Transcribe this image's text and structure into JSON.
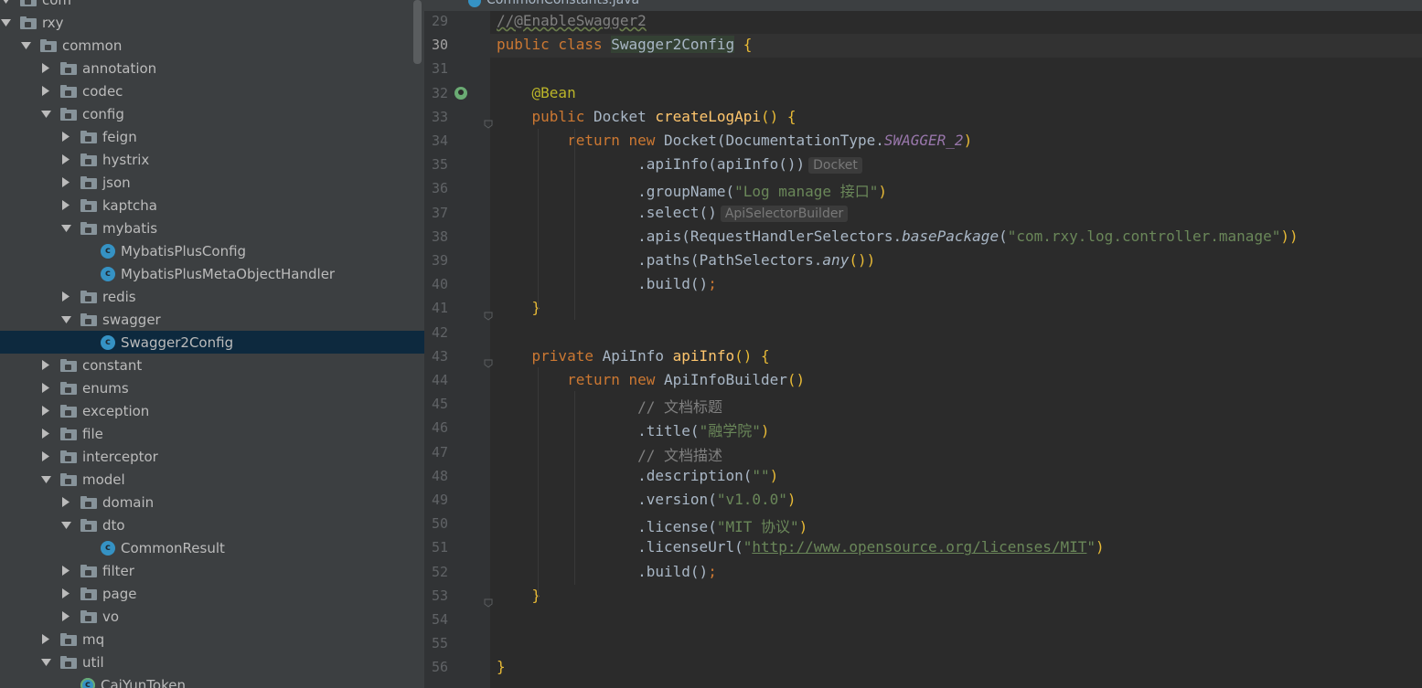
{
  "tab": {
    "title": "CommonConstants.java"
  },
  "tree": {
    "items": [
      {
        "label": "com",
        "depth": 0,
        "kind": "folder",
        "state": "expanded"
      },
      {
        "label": "rxy",
        "depth": 0,
        "kind": "folder",
        "state": "expanded"
      },
      {
        "label": "common",
        "depth": 1,
        "kind": "folder",
        "state": "expanded"
      },
      {
        "label": "annotation",
        "depth": 2,
        "kind": "folder",
        "state": "collapsed"
      },
      {
        "label": "codec",
        "depth": 2,
        "kind": "folder",
        "state": "collapsed"
      },
      {
        "label": "config",
        "depth": 2,
        "kind": "folder",
        "state": "expanded"
      },
      {
        "label": "feign",
        "depth": 3,
        "kind": "folder",
        "state": "collapsed"
      },
      {
        "label": "hystrix",
        "depth": 3,
        "kind": "folder",
        "state": "collapsed"
      },
      {
        "label": "json",
        "depth": 3,
        "kind": "folder",
        "state": "collapsed"
      },
      {
        "label": "kaptcha",
        "depth": 3,
        "kind": "folder",
        "state": "collapsed"
      },
      {
        "label": "mybatis",
        "depth": 3,
        "kind": "folder",
        "state": "expanded"
      },
      {
        "label": "MybatisPlusConfig",
        "depth": 4,
        "kind": "class"
      },
      {
        "label": "MybatisPlusMetaObjectHandler",
        "depth": 4,
        "kind": "class"
      },
      {
        "label": "redis",
        "depth": 3,
        "kind": "folder",
        "state": "collapsed"
      },
      {
        "label": "swagger",
        "depth": 3,
        "kind": "folder",
        "state": "expanded"
      },
      {
        "label": "Swagger2Config",
        "depth": 4,
        "kind": "class",
        "selected": true
      },
      {
        "label": "constant",
        "depth": 2,
        "kind": "folder",
        "state": "collapsed"
      },
      {
        "label": "enums",
        "depth": 2,
        "kind": "folder",
        "state": "collapsed"
      },
      {
        "label": "exception",
        "depth": 2,
        "kind": "folder",
        "state": "collapsed"
      },
      {
        "label": "file",
        "depth": 2,
        "kind": "folder",
        "state": "collapsed"
      },
      {
        "label": "interceptor",
        "depth": 2,
        "kind": "folder",
        "state": "collapsed"
      },
      {
        "label": "model",
        "depth": 2,
        "kind": "folder",
        "state": "expanded"
      },
      {
        "label": "domain",
        "depth": 3,
        "kind": "folder",
        "state": "collapsed"
      },
      {
        "label": "dto",
        "depth": 3,
        "kind": "folder",
        "state": "expanded"
      },
      {
        "label": "CommonResult",
        "depth": 4,
        "kind": "class"
      },
      {
        "label": "filter",
        "depth": 3,
        "kind": "folder",
        "state": "collapsed"
      },
      {
        "label": "page",
        "depth": 3,
        "kind": "folder",
        "state": "collapsed"
      },
      {
        "label": "vo",
        "depth": 3,
        "kind": "folder",
        "state": "collapsed"
      },
      {
        "label": "mq",
        "depth": 2,
        "kind": "folder",
        "state": "collapsed"
      },
      {
        "label": "util",
        "depth": 2,
        "kind": "folder",
        "state": "expanded"
      },
      {
        "label": "CaiYunToken",
        "depth": 3,
        "kind": "class-spring"
      }
    ]
  },
  "editor": {
    "current_line": 30,
    "lines": [
      {
        "n": 29,
        "tokens": [
          {
            "t": "//@EnableSwagger2",
            "c": "cmu"
          }
        ]
      },
      {
        "n": 30,
        "tokens": [
          {
            "t": "public class ",
            "c": "kw"
          },
          {
            "t": "Swagger2Config",
            "c": "hl"
          },
          {
            "t": " {",
            "c": "py"
          }
        ]
      },
      {
        "n": 31,
        "tokens": []
      },
      {
        "n": 32,
        "tokens": [
          {
            "t": "    "
          },
          {
            "t": "@Bean",
            "c": "an"
          }
        ]
      },
      {
        "n": 33,
        "tokens": [
          {
            "t": "    "
          },
          {
            "t": "public ",
            "c": "kw"
          },
          {
            "t": "Docket "
          },
          {
            "t": "createLogApi",
            "c": "fn"
          },
          {
            "t": "() {",
            "c": "py"
          }
        ]
      },
      {
        "n": 34,
        "tokens": [
          {
            "t": "        "
          },
          {
            "t": "return new ",
            "c": "kw"
          },
          {
            "t": "Docket("
          },
          {
            "t": "DocumentationType."
          },
          {
            "t": "SWAGGER_2",
            "c": "sf"
          },
          {
            "t": ")",
            "c": "py"
          }
        ]
      },
      {
        "n": 35,
        "tokens": [
          {
            "t": "                .apiInfo("
          },
          {
            "t": "apiInfo())"
          },
          {
            "t": "Docket",
            "c": "hint"
          }
        ]
      },
      {
        "n": 36,
        "tokens": [
          {
            "t": "                .groupName("
          },
          {
            "t": "\"Log manage 接口\"",
            "c": "st"
          },
          {
            "t": ")",
            "c": "py"
          }
        ]
      },
      {
        "n": 37,
        "tokens": [
          {
            "t": "                .select()"
          },
          {
            "t": "ApiSelectorBuilder",
            "c": "hint"
          }
        ]
      },
      {
        "n": 38,
        "tokens": [
          {
            "t": "                .apis("
          },
          {
            "t": "RequestHandlerSelectors."
          },
          {
            "t": "basePackage",
            "c": "it"
          },
          {
            "t": "("
          },
          {
            "t": "\"com.rxy.log.controller.manage\"",
            "c": "st"
          },
          {
            "t": "))",
            "c": "py"
          }
        ]
      },
      {
        "n": 39,
        "tokens": [
          {
            "t": "                .paths("
          },
          {
            "t": "PathSelectors."
          },
          {
            "t": "any",
            "c": "it"
          },
          {
            "t": "())",
            "c": "py"
          }
        ]
      },
      {
        "n": 40,
        "tokens": [
          {
            "t": "                .build()"
          },
          {
            "t": ";",
            "c": "kw"
          }
        ]
      },
      {
        "n": 41,
        "tokens": [
          {
            "t": "    "
          },
          {
            "t": "}",
            "c": "py"
          }
        ]
      },
      {
        "n": 42,
        "tokens": []
      },
      {
        "n": 43,
        "tokens": [
          {
            "t": "    "
          },
          {
            "t": "private ",
            "c": "kw"
          },
          {
            "t": "ApiInfo "
          },
          {
            "t": "apiInfo",
            "c": "fn"
          },
          {
            "t": "() {",
            "c": "py"
          }
        ]
      },
      {
        "n": 44,
        "tokens": [
          {
            "t": "        "
          },
          {
            "t": "return new ",
            "c": "kw"
          },
          {
            "t": "ApiInfoBuilder"
          },
          {
            "t": "()",
            "c": "py"
          }
        ]
      },
      {
        "n": 45,
        "tokens": [
          {
            "t": "                "
          },
          {
            "t": "// 文档标题",
            "c": "cm"
          }
        ]
      },
      {
        "n": 46,
        "tokens": [
          {
            "t": "                .title("
          },
          {
            "t": "\"融学院\"",
            "c": "st"
          },
          {
            "t": ")",
            "c": "py"
          }
        ]
      },
      {
        "n": 47,
        "tokens": [
          {
            "t": "                "
          },
          {
            "t": "// 文档描述",
            "c": "cm"
          }
        ]
      },
      {
        "n": 48,
        "tokens": [
          {
            "t": "                .description("
          },
          {
            "t": "\"\"",
            "c": "st"
          },
          {
            "t": ")",
            "c": "py"
          }
        ]
      },
      {
        "n": 49,
        "tokens": [
          {
            "t": "                .version("
          },
          {
            "t": "\"v1.0.0\"",
            "c": "st"
          },
          {
            "t": ")",
            "c": "py"
          }
        ]
      },
      {
        "n": 50,
        "tokens": [
          {
            "t": "                .license("
          },
          {
            "t": "\"MIT 协议\"",
            "c": "st"
          },
          {
            "t": ")",
            "c": "py"
          }
        ]
      },
      {
        "n": 51,
        "tokens": [
          {
            "t": "                .licenseUrl("
          },
          {
            "t": "\"",
            "c": "st"
          },
          {
            "t": "http://www.opensource.org/licenses/MIT",
            "c": "lk"
          },
          {
            "t": "\"",
            "c": "st"
          },
          {
            "t": ")",
            "c": "py"
          }
        ]
      },
      {
        "n": 52,
        "tokens": [
          {
            "t": "                .build()"
          },
          {
            "t": ";",
            "c": "kw"
          }
        ]
      },
      {
        "n": 53,
        "tokens": [
          {
            "t": "    "
          },
          {
            "t": "}",
            "c": "py"
          }
        ]
      },
      {
        "n": 54,
        "tokens": []
      },
      {
        "n": 55,
        "tokens": []
      },
      {
        "n": 56,
        "tokens": [
          {
            "t": "}",
            "c": "py"
          }
        ]
      }
    ]
  },
  "colors": {
    "tree_bg": "#3c3f41",
    "editor_bg": "#2b2b2b",
    "selection": "#0d293e",
    "keyword": "#cc7832",
    "string": "#6a8759",
    "function": "#ffc66d"
  },
  "icons": {
    "folder": "folder-icon",
    "class": "java-class-icon",
    "bean": "spring-bean-gutter-icon",
    "arrow_expanded": "chevron-down-icon",
    "arrow_collapsed": "chevron-right-icon"
  }
}
